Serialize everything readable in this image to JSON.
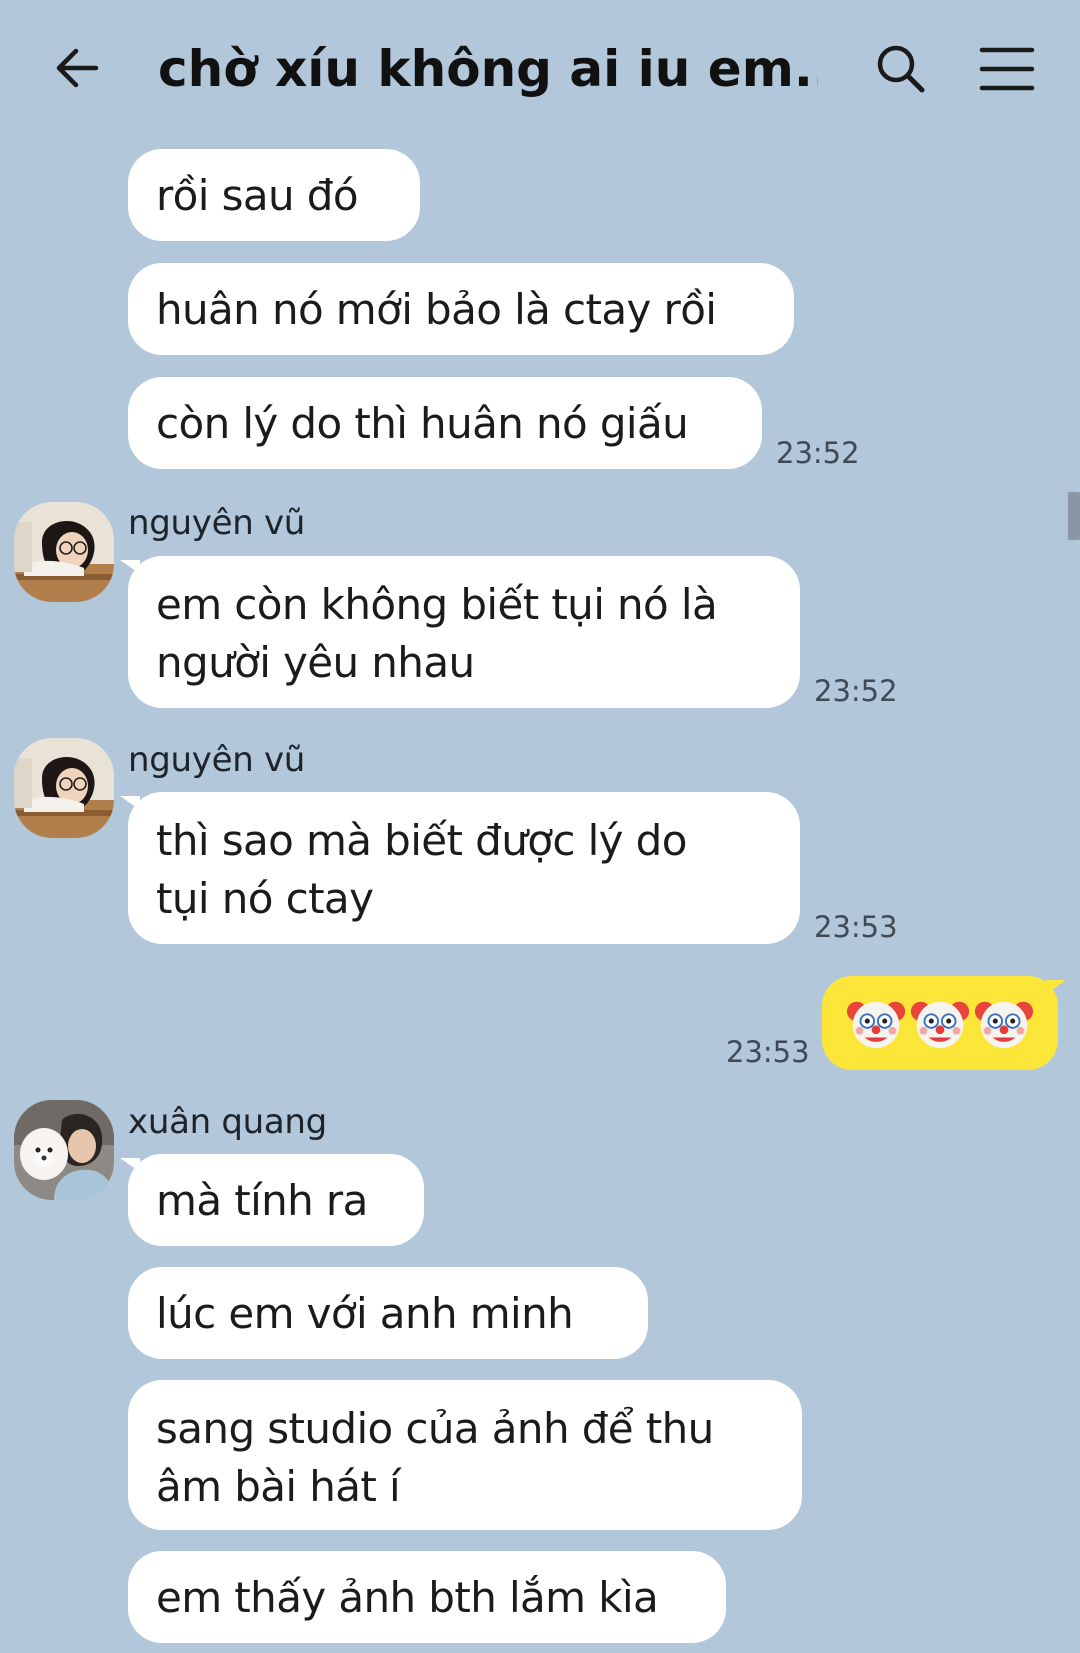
{
  "header": {
    "title": "chờ xíu không ai iu em...",
    "back_icon": "arrow-left-icon",
    "search_icon": "search-icon",
    "menu_icon": "hamburger-menu-icon"
  },
  "colors": {
    "background": "#b3c7db",
    "incoming_bubble": "#ffffff",
    "outgoing_bubble": "#fde63a"
  },
  "messages": [
    {
      "text": "rồi sau đó"
    },
    {
      "text": "huân nó mới bảo là ctay rồi"
    },
    {
      "text": "còn lý do thì huân nó giấu",
      "time": "23:52"
    },
    {
      "sender": "nguyên vũ",
      "lines": [
        "em còn không biết tụi nó là",
        "người yêu nhau"
      ],
      "time": "23:52"
    },
    {
      "sender": "nguyên vũ",
      "lines": [
        "thì sao mà biết được lý do",
        "tụi nó ctay"
      ],
      "time": "23:53"
    },
    {
      "own": true,
      "emoji": [
        "clown-face",
        "clown-face",
        "clown-face"
      ],
      "time": "23:53"
    },
    {
      "sender": "xuân quang",
      "text": "mà tính ra"
    },
    {
      "text": "lúc em với anh minh"
    },
    {
      "lines": [
        "sang studio của ảnh để thu",
        "âm bài hát í"
      ]
    },
    {
      "text": "em thấy ảnh bth lắm kìa"
    }
  ]
}
